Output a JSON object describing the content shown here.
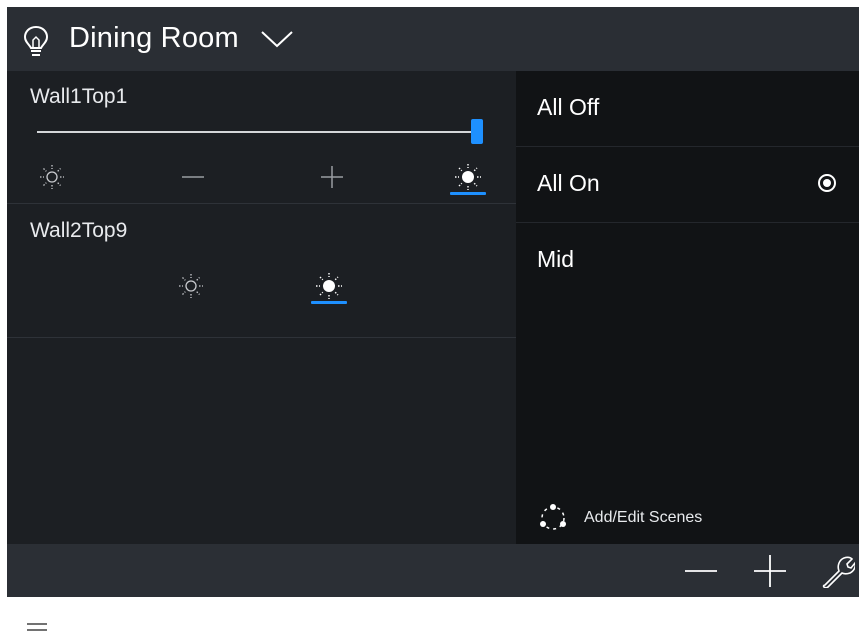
{
  "header": {
    "title": "Dining Room",
    "icon": "lightbulb-icon"
  },
  "loads": [
    {
      "name": "Wall1Top1",
      "slider_level_percent": 100,
      "active_control": "bright"
    },
    {
      "name": "Wall2Top9",
      "active_control": "bright"
    }
  ],
  "scenes": [
    {
      "label": "All Off",
      "selected": false
    },
    {
      "label": "All On",
      "selected": true
    },
    {
      "label": "Mid",
      "selected": false
    }
  ],
  "add_scenes": {
    "label": "Add/Edit Scenes"
  },
  "colors": {
    "accent": "#1e90ff",
    "header": "#2a2e34",
    "panel": "#1c1f23",
    "scenes_panel": "#111315"
  }
}
